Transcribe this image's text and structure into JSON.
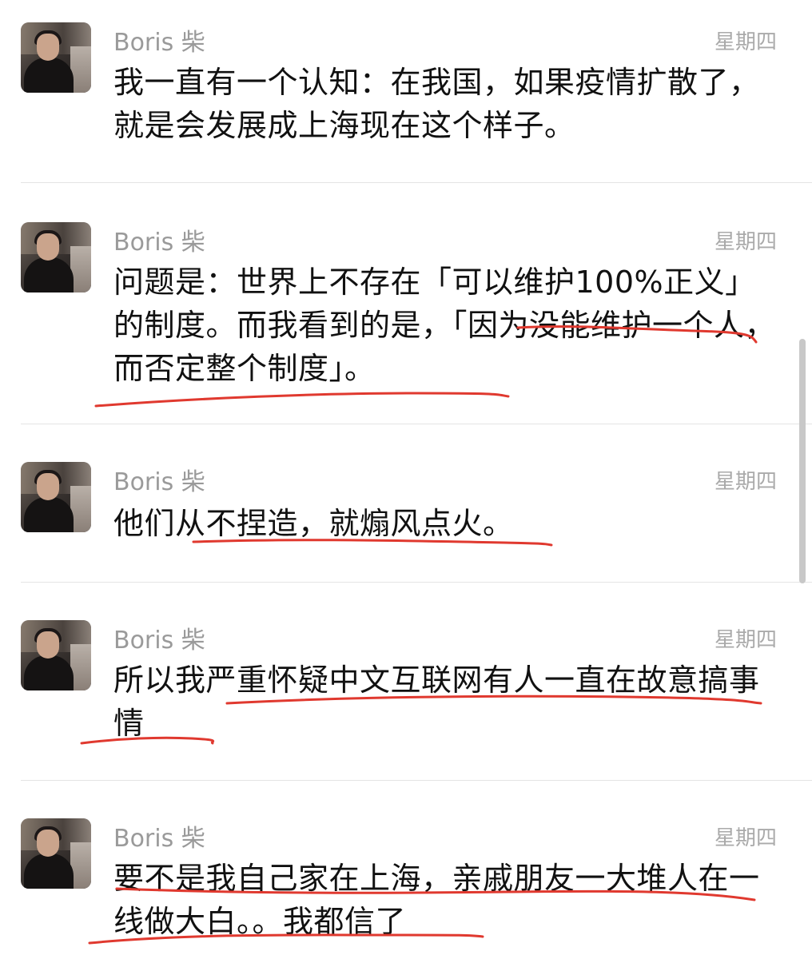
{
  "messages": [
    {
      "sender": "Boris 柴",
      "time": "星期四",
      "text": "我一直有一个认知：在我国，如果疫情扩散了，就是会发展成上海现在这个样子。"
    },
    {
      "sender": "Boris 柴",
      "time": "星期四",
      "text": "问题是：世界上不存在「可以维护100%正义」的制度。而我看到的是，「因为没能维护一个人，而否定整个制度」。"
    },
    {
      "sender": "Boris 柴",
      "time": "星期四",
      "text": "他们从不捏造，就煽风点火。"
    },
    {
      "sender": "Boris 柴",
      "time": "星期四",
      "text": "所以我严重怀疑中文互联网有人一直在故意搞事情"
    },
    {
      "sender": "Boris 柴",
      "time": "星期四",
      "text": "要不是我自己家在上海，亲戚朋友一大堆人在一线做大白。。我都信了"
    }
  ],
  "annotation_color": "#e0392f",
  "avatar_icon": "user-photo-avatar"
}
